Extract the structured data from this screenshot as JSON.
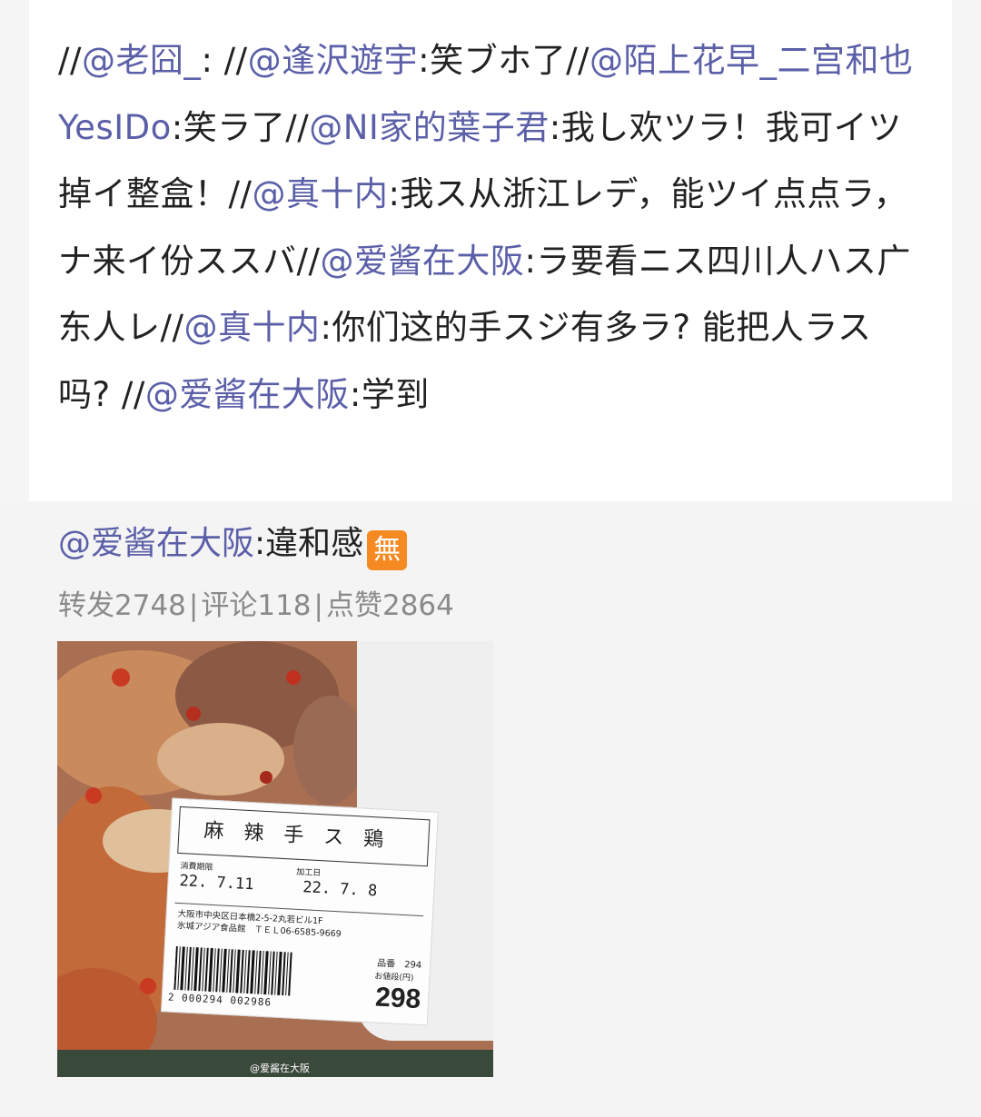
{
  "repost": {
    "segments": [
      {
        "text": "//",
        "mention": false
      },
      {
        "text": "@老囧_",
        "mention": true
      },
      {
        "text": ": //",
        "mention": false
      },
      {
        "text": "@逢沢遊宇",
        "mention": true
      },
      {
        "text": ":笑ブホ了//",
        "mention": false
      },
      {
        "text": "@陌上花早_二宫和也YesIDo",
        "mention": true
      },
      {
        "text": ":笑ラ了//",
        "mention": false
      },
      {
        "text": "@NI家的葉子君",
        "mention": true
      },
      {
        "text": ":我し欢ツラ！我可イツ掉イ整盒！//",
        "mention": false
      },
      {
        "text": "@真十内",
        "mention": true
      },
      {
        "text": ":我ス从浙江レデ，能ツイ点点ラ，ナ来イ份ススバ//",
        "mention": false
      },
      {
        "text": "@爱酱在大阪",
        "mention": true
      },
      {
        "text": ":ラ要看ニス四川人ハス广东人レ//",
        "mention": false
      },
      {
        "text": "@真十内",
        "mention": true
      },
      {
        "text": ":你们这的手スジ有多ラ? 能把人ラス吗? //",
        "mention": false
      },
      {
        "text": "@爱酱在大阪",
        "mention": true
      },
      {
        "text": ":学到",
        "mention": false
      }
    ]
  },
  "original": {
    "author": "@爱酱在大阪",
    "text": ":違和感",
    "badge": "無",
    "badge_color": "#f58a23",
    "stats": {
      "repost": "转发2748",
      "comment": "评论118",
      "like": "点赞2864",
      "separator": "|"
    }
  },
  "image": {
    "watermark": "@爱酱在大阪",
    "label": {
      "product": "麻辣手ス鶏",
      "expiry_label": "消費期限",
      "expiry": "22. 7.11",
      "made_label": "加工日",
      "made": "22. 7. 8",
      "address": "大阪市中央区日本橋2-5-2丸若ビル1F",
      "shop": "氷城アジア食品館　ＴＥＬ06-6585-9669",
      "barcode": "2 000294 002986",
      "item_no": "品番　294",
      "price_label": "お値段(円)",
      "price": "298"
    }
  },
  "colors": {
    "mention": "#5b5fa8",
    "stats": "#8a8a8a"
  }
}
